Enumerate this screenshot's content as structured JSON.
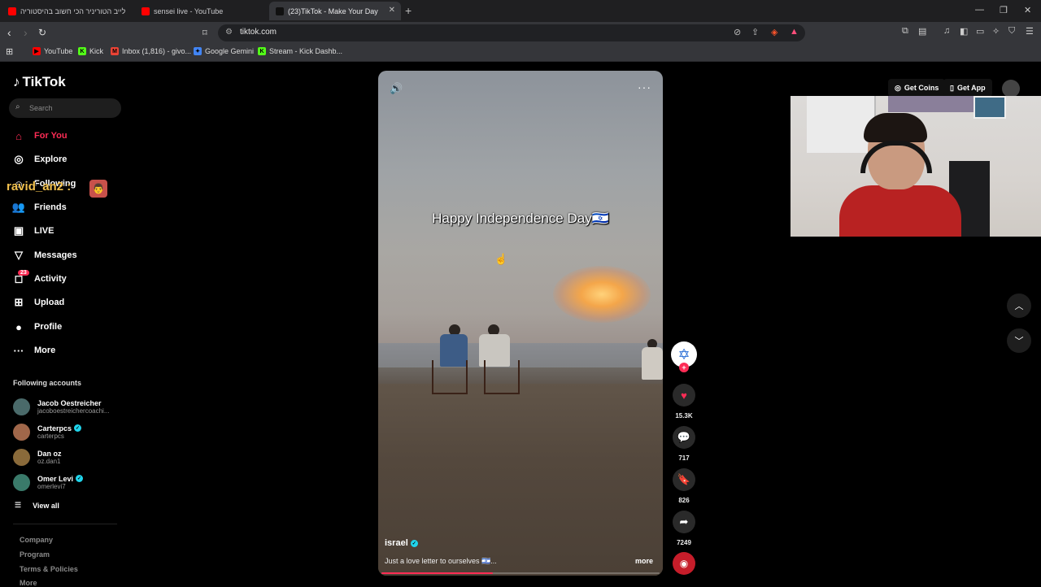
{
  "browser": {
    "tabs": [
      {
        "title": "לייב הטוריניר הכי חשוב בהיסטוריה",
        "fav_color": "#ff0000",
        "muted": true
      },
      {
        "title": "sensei live - YouTube",
        "fav_color": "#ff0000"
      },
      {
        "title": "(23)TikTok - Make Your Day",
        "fav_color": "#111111",
        "active": true
      }
    ],
    "url": "tiktok.com",
    "bookmarks": [
      {
        "label": "YouTube",
        "color": "#ff0000",
        "glyph": "▶"
      },
      {
        "label": "Kick",
        "color": "#53fc18",
        "glyph": "K"
      },
      {
        "label": "Inbox (1,816) - givo...",
        "color": "#ea4335",
        "glyph": "M"
      },
      {
        "label": "Google Gemini",
        "color": "#4285f4",
        "glyph": "✦"
      },
      {
        "label": "Stream - Kick Dashb...",
        "color": "#53fc18",
        "glyph": "K"
      }
    ]
  },
  "sidebar": {
    "logo": "TikTok",
    "search_placeholder": "Search",
    "nav": [
      {
        "label": "For You",
        "icon": "home-icon",
        "glyph": "⌂",
        "active": true
      },
      {
        "label": "Explore",
        "icon": "compass-icon",
        "glyph": "◎"
      },
      {
        "label": "Following",
        "icon": "following-icon",
        "glyph": "☺"
      },
      {
        "label": "Friends",
        "icon": "friends-icon",
        "glyph": "👥"
      },
      {
        "label": "LIVE",
        "icon": "live-icon",
        "glyph": "▣"
      },
      {
        "label": "Messages",
        "icon": "messages-icon",
        "glyph": "▽"
      },
      {
        "label": "Activity",
        "icon": "activity-icon",
        "glyph": "◻",
        "badge": "23"
      },
      {
        "label": "Upload",
        "icon": "upload-icon",
        "glyph": "⊞"
      },
      {
        "label": "Profile",
        "icon": "profile-icon",
        "glyph": "●"
      },
      {
        "label": "More",
        "icon": "more-icon",
        "glyph": "···"
      }
    ],
    "overlay_name": "ravid_an2 :",
    "following_title": "Following accounts",
    "accounts": [
      {
        "name": "Jacob Oestreicher",
        "handle": "jacoboestreichercoachi...",
        "verified": false,
        "color": "#4a6a6a"
      },
      {
        "name": "Carterpcs",
        "handle": "carterpcs",
        "verified": true,
        "color": "#a0674a"
      },
      {
        "name": "Dan oz",
        "handle": "oz.dan1",
        "verified": false,
        "color": "#8a6a3a"
      },
      {
        "name": "Omer Levi",
        "handle": "omerlevi7",
        "verified": true,
        "color": "#3a7a6a"
      }
    ],
    "view_all": "View all",
    "footer": [
      "Company",
      "Program",
      "Terms & Policies",
      "More"
    ]
  },
  "video": {
    "caption": "Happy Independence Day🇮🇱",
    "author": "israel",
    "verified": true,
    "description": "Just a love letter to ourselves 🇮🇱...",
    "more_label": "more",
    "progress": 0.4
  },
  "actions": {
    "likes": "15.3K",
    "comments": "717",
    "saves": "826",
    "shares": "7249"
  },
  "topbar": {
    "get_coins": "Get Coins",
    "get_app": "Get App"
  },
  "colors": {
    "accent": "#fe2c55",
    "verified": "#20d5ec"
  }
}
